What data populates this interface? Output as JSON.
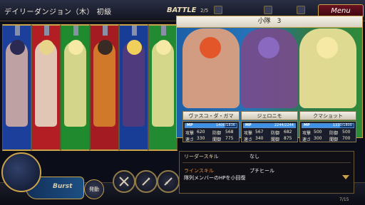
{
  "header": {
    "stage_title": "デイリーダンジョン（木） 初級",
    "battle_label": "BATTLE",
    "wave_count": "2/5",
    "menu_label": "Menu"
  },
  "party_banners": [
    {
      "color": "#1b3f9a",
      "icon": "party-member-1-portrait"
    },
    {
      "color": "#b31d24",
      "icon": "party-member-2-portrait"
    },
    {
      "color": "#1f8a2e",
      "icon": "teddy-bear-portrait"
    },
    {
      "color": "#a51b22",
      "icon": "party-member-4-portrait"
    },
    {
      "color": "#183d96",
      "icon": "party-member-5-portrait"
    },
    {
      "color": "#238a34",
      "icon": "teddy-bear-portrait"
    }
  ],
  "squad": {
    "title": "小隊　3",
    "members": [
      {
        "name": "ヴァスコ・ダ・ガマ",
        "mp_label": "MP",
        "mp_value": "1406/1836",
        "mp_fraction": 0.766,
        "atk_label": "攻撃",
        "atk": "620",
        "def_label": "防御",
        "def": "568",
        "spd_label": "速さ",
        "spd": "330",
        "mdef_label": "聞御",
        "mdef": "775",
        "bg": "#2470b6"
      },
      {
        "name": "ジェロニモ",
        "mp_label": "MP",
        "mp_value": "2244/2244",
        "mp_fraction": 1.0,
        "atk_label": "攻撃",
        "atk": "567",
        "def_label": "防御",
        "def": "682",
        "spd_label": "速さ",
        "spd": "340",
        "mdef_label": "聞御",
        "mdef": "875",
        "bg": "#2a7a44"
      },
      {
        "name": "クマショット",
        "mp_label": "MP",
        "mp_value": "1330/1800",
        "mp_fraction": 0.739,
        "atk_label": "攻撃",
        "atk": "500",
        "def_label": "防御",
        "def": "500",
        "spd_label": "速さ",
        "spd": "300",
        "mdef_label": "聞御",
        "mdef": "700",
        "bg": "#2f8a3a"
      }
    ]
  },
  "skills": {
    "leader_label": "リーダースキル",
    "leader_value": "なし",
    "line_label": "ラインスキル",
    "line_value": "プチヒール",
    "line_desc": "隊列メンバーのHPを小回復"
  },
  "page_count": "7/15",
  "bottom": {
    "burst_label": "Burst",
    "activate_label": "発動",
    "skill_icons": [
      "crossed-swords-icon",
      "dagger-icon",
      "sword-icon",
      "shield-sword-icon"
    ]
  }
}
